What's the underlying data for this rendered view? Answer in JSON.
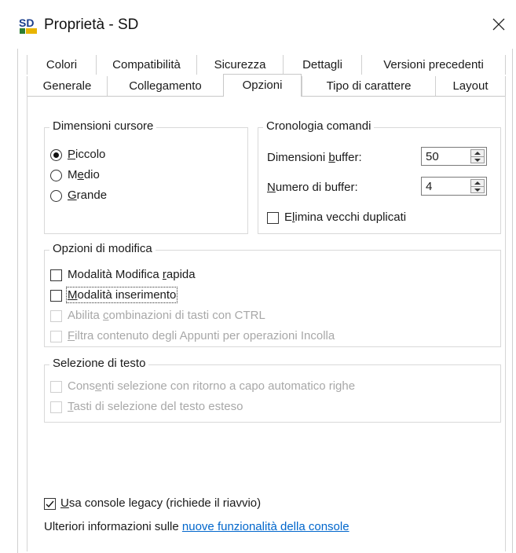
{
  "window": {
    "title": "Proprietà - SD",
    "icon_text": "SD",
    "close_icon": "close-icon"
  },
  "tabs": {
    "row1": [
      "Colori",
      "Compatibilità",
      "Sicurezza",
      "Dettagli",
      "Versioni precedenti"
    ],
    "row2": [
      "Generale",
      "Collegamento",
      "Opzioni",
      "Tipo di carattere",
      "Layout"
    ],
    "selected": "Opzioni"
  },
  "cursor_size": {
    "label": "Dimensioni cursore",
    "options": [
      {
        "pre": "",
        "ul": "P",
        "post": "iccolo",
        "selected": true
      },
      {
        "pre": "M",
        "ul": "e",
        "post": "dio",
        "selected": false
      },
      {
        "pre": "",
        "ul": "G",
        "post": "rande",
        "selected": false
      }
    ]
  },
  "history": {
    "label": "Cronologia comandi",
    "buffer_size": {
      "pre": "Dimensioni ",
      "ul": "b",
      "post": "uffer:",
      "value": "50"
    },
    "buffer_count": {
      "pre": "",
      "ul": "N",
      "post": "umero di buffer:",
      "value": "4"
    },
    "discard_duplicates": {
      "pre": "E",
      "ul": "l",
      "post": "imina vecchi duplicati",
      "checked": false
    }
  },
  "edit_options": {
    "label": "Opzioni di modifica",
    "items": [
      {
        "pre": "Modalità Modifica ",
        "ul": "r",
        "post": "apida",
        "checked": false,
        "disabled": false
      },
      {
        "pre": "",
        "ul": "M",
        "post": "odalità inserimento",
        "checked": false,
        "disabled": false
      },
      {
        "pre": "Abilita ",
        "ul": "c",
        "post": "ombinazioni di tasti con CTRL",
        "checked": false,
        "disabled": true
      },
      {
        "pre": "",
        "ul": "F",
        "post": "iltra contenuto degli Appunti per operazioni Incolla",
        "checked": false,
        "disabled": true
      }
    ]
  },
  "text_selection": {
    "label": "Selezione di testo",
    "items": [
      {
        "pre": "Cons",
        "ul": "e",
        "post": "nti selezione con ritorno a capo automatico righe",
        "checked": false,
        "disabled": true
      },
      {
        "pre": "",
        "ul": "T",
        "post": "asti di selezione del testo esteso",
        "checked": false,
        "disabled": true
      }
    ]
  },
  "legacy": {
    "pre": "",
    "ul": "U",
    "post": "sa console legacy (richiede il riavvio)",
    "checked": true
  },
  "info": {
    "text": "Ulteriori informazioni sulle ",
    "link": "nuove funzionalità della console"
  },
  "colors": {
    "link": "#0066cc",
    "disabled_text": "#a8a8a8"
  }
}
